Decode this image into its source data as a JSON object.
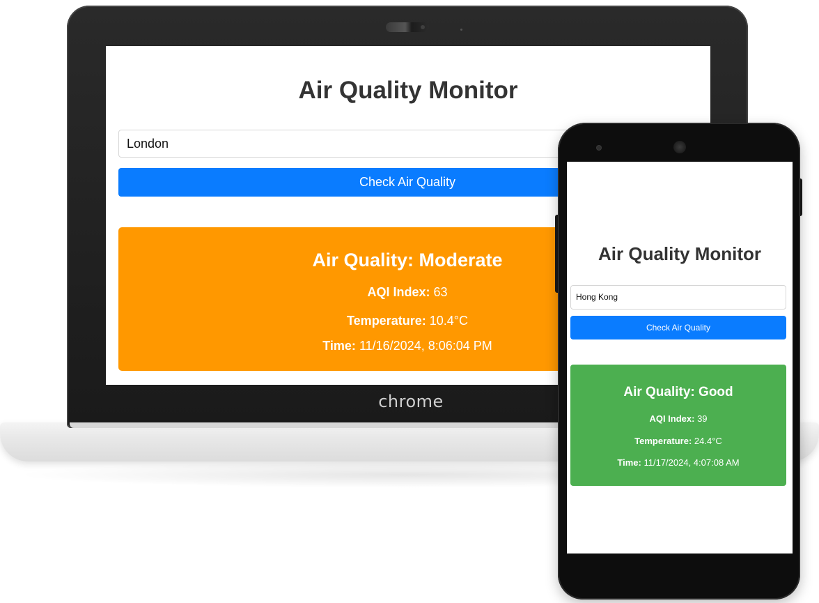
{
  "laptop": {
    "brand": "chrome",
    "app": {
      "title": "Air Quality Monitor",
      "city_input_value": "London",
      "button_label": "Check Air Quality",
      "result": {
        "status_title": "Air Quality: Moderate",
        "aqi_label": "AQI Index:",
        "aqi_value": "63",
        "temp_label": "Temperature:",
        "temp_value": "10.4°C",
        "time_label": "Time:",
        "time_value": "11/16/2024, 8:06:04 PM",
        "color": "#ff9800"
      }
    }
  },
  "phone": {
    "app": {
      "title": "Air Quality Monitor",
      "city_input_value": "Hong Kong",
      "button_label": "Check Air Quality",
      "result": {
        "status_title": "Air Quality: Good",
        "aqi_label": "AQI Index:",
        "aqi_value": "39",
        "temp_label": "Temperature:",
        "temp_value": "24.4°C",
        "time_label": "Time:",
        "time_value": "11/17/2024, 4:07:08 AM",
        "color": "#4caf50"
      }
    }
  },
  "colors": {
    "button_blue": "#0a7cff",
    "title_text": "#333333"
  }
}
